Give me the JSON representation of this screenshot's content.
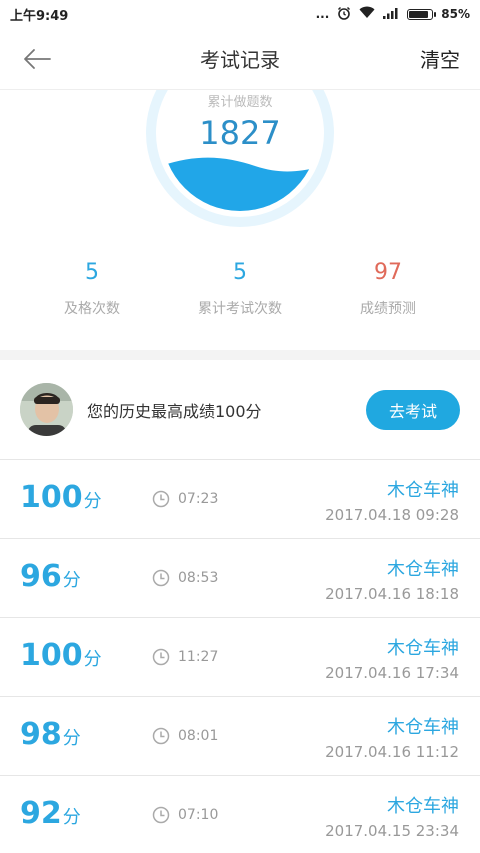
{
  "status_bar": {
    "time": "上午9:49",
    "dots": "...",
    "battery_percent": "85%",
    "battery_level": 0.85
  },
  "nav": {
    "title": "考试记录",
    "clear_label": "清空",
    "back_icon": "arrow-left-icon"
  },
  "summary": {
    "total_label": "累计做题数",
    "total_value": "1827",
    "stats": [
      {
        "value": "5",
        "label": "及格次数",
        "color": "#2ca7e0"
      },
      {
        "value": "5",
        "label": "累计考试次数",
        "color": "#2ca7e0"
      },
      {
        "value": "97",
        "label": "成绩预测",
        "color": "#e06a5a"
      }
    ]
  },
  "best": {
    "text": "您的历史最高成绩100分",
    "button_label": "去考试"
  },
  "records": [
    {
      "score": "100",
      "unit": "分",
      "duration": "07:23",
      "driver": "木仓车神",
      "date": "2017.04.18  09:28"
    },
    {
      "score": "96",
      "unit": "分",
      "duration": "08:53",
      "driver": "木仓车神",
      "date": "2017.04.16  18:18"
    },
    {
      "score": "100",
      "unit": "分",
      "duration": "11:27",
      "driver": "木仓车神",
      "date": "2017.04.16  17:34"
    },
    {
      "score": "98",
      "unit": "分",
      "duration": "08:01",
      "driver": "木仓车神",
      "date": "2017.04.16  11:12"
    },
    {
      "score": "92",
      "unit": "分",
      "duration": "07:10",
      "driver": "木仓车神",
      "date": "2017.04.15  23:34"
    }
  ],
  "colors": {
    "accent": "#2ca7e0",
    "prediction": "#e06a5a",
    "button": "#20a8e0"
  }
}
